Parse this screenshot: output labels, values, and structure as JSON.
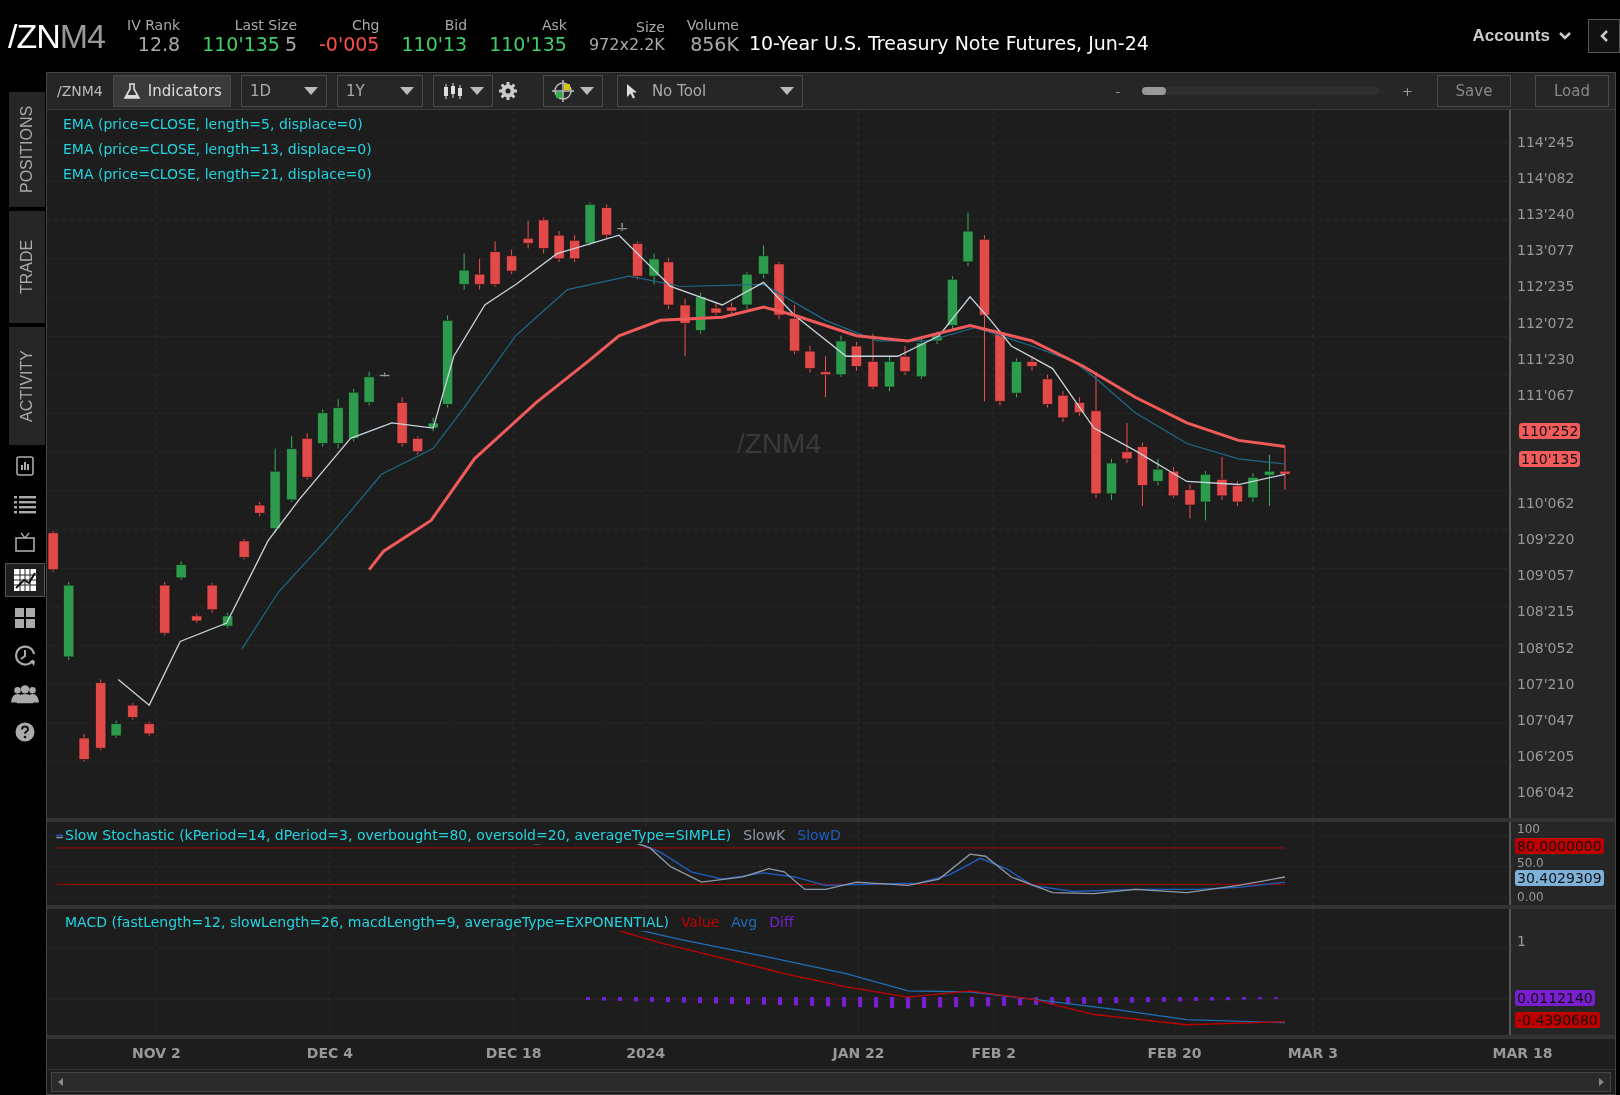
{
  "symbol": {
    "root": "/ZN",
    "suffix": "M4"
  },
  "quote_fields": [
    {
      "label": "IV Rank",
      "values": [
        {
          "text": "12.8",
          "color": "#aaaaaa",
          "kind": "large"
        }
      ]
    },
    {
      "label": "Last Size",
      "values": [
        {
          "text": "110'135",
          "color": "#3fcf6a",
          "kind": "large"
        },
        {
          "text": "5",
          "color": "#aaaaaa",
          "kind": "large"
        }
      ]
    },
    {
      "label": "Chg",
      "values": [
        {
          "text": "-0'005",
          "color": "#ff4d4d",
          "kind": "large"
        }
      ]
    },
    {
      "label": "Bid",
      "values": [
        {
          "text": "110'13",
          "color": "#3fcf6a",
          "kind": "large"
        }
      ]
    },
    {
      "label": "Ask",
      "values": [
        {
          "text": "110'135",
          "color": "#3fcf6a",
          "kind": "large"
        }
      ]
    },
    {
      "label": "Size",
      "values": [
        {
          "text": "972x2.2K",
          "color": "#aaaaaa",
          "kind": "small"
        }
      ]
    },
    {
      "label": "Volume",
      "values": [
        {
          "text": "856K",
          "color": "#aaaaaa",
          "kind": "large"
        }
      ]
    }
  ],
  "description": "10-Year U.S. Treasury Note Futures, Jun-24",
  "accounts_label": "Accounts",
  "sidebar": {
    "tabs": [
      {
        "label": "POSITIONS"
      },
      {
        "label": "TRADE"
      },
      {
        "label": "ACTIVITY"
      }
    ],
    "icons": [
      {
        "kind": "book",
        "selected": false
      },
      {
        "kind": "list",
        "selected": false
      },
      {
        "kind": "tv",
        "selected": false
      },
      {
        "kind": "chart",
        "selected": true
      },
      {
        "kind": "grid",
        "selected": false
      },
      {
        "kind": "clock",
        "selected": false
      },
      {
        "kind": "people",
        "selected": false
      },
      {
        "kind": "help",
        "selected": false
      }
    ]
  },
  "toolbar": {
    "symbol": "/ZNM4",
    "indicators": "Indicators",
    "aggregation": "1D",
    "timeframe": "1Y",
    "tool": "No Tool",
    "zoom_minus": "-",
    "zoom_plus": "+",
    "zoom": {
      "level": 0.1
    },
    "save": "Save",
    "load": "Load"
  },
  "main_chart": {
    "watermark": "/ZNM4",
    "studies": [
      "EMA (price=CLOSE, length=5, displace=0)",
      "EMA (price=CLOSE, length=13, displace=0)",
      "EMA (price=CLOSE, length=21, displace=0)"
    ],
    "price_axis": [
      "114'245",
      "114'082",
      "113'240",
      "113'077",
      "112'235",
      "112'072",
      "111'230",
      "111'067",
      "110'062",
      "109'220",
      "109'057",
      "108'215",
      "108'052",
      "107'210",
      "107'047",
      "106'205",
      "106'042"
    ],
    "price_tags": [
      {
        "text": "110'252",
        "color": "#f25b5b"
      },
      {
        "text": "110'135",
        "color": "#f25b5b"
      }
    ]
  },
  "stochastic": {
    "title": "Slow Stochastic (kPeriod=14, dPeriod=3, overbought=80, oversold=20, averageType=SIMPLE)",
    "legend": [
      {
        "label": "SlowK",
        "color": "#8e9aa6"
      },
      {
        "label": "SlowD",
        "color": "#1f5fc0"
      }
    ],
    "axis": [
      "100",
      "50.0",
      "0.00"
    ],
    "tags": [
      {
        "text": "80.0000000",
        "color": "#c00000"
      },
      {
        "text": "30.4029309",
        "color": "#7fb2d8"
      }
    ]
  },
  "macd": {
    "title": "MACD (fastLength=12, slowLength=26, macdLength=9, averageType=EXPONENTIAL)",
    "legend": [
      {
        "label": "Value",
        "color": "#c00000"
      },
      {
        "label": "Avg",
        "color": "#1f6fb8"
      },
      {
        "label": "Diff",
        "color": "#7a1fd0"
      }
    ],
    "axis": [
      "1"
    ],
    "tags": [
      {
        "text": "0.0112140",
        "color": "#7a1fd0"
      },
      {
        "text": "-0.4390680",
        "color": "#c00000"
      }
    ]
  },
  "date_axis": [
    "NOV 2",
    "DEC 4",
    "DEC 18",
    "2024",
    "JAN 22",
    "FEB 2",
    "FEB 20",
    "MAR 3",
    "MAR 18"
  ]
}
